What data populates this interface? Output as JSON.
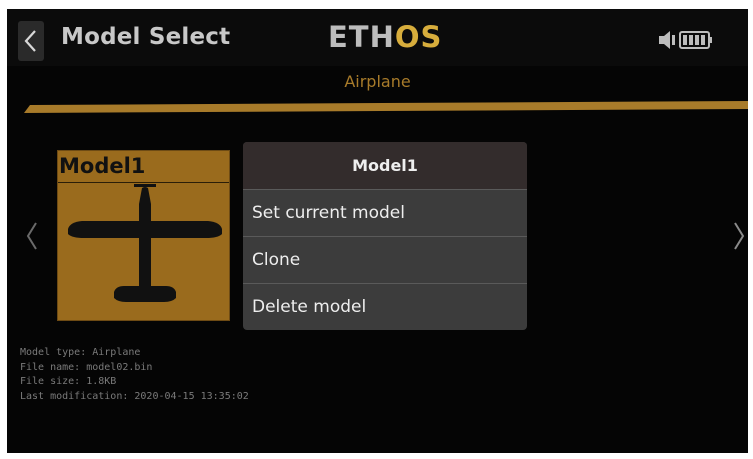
{
  "header": {
    "back_icon": "chevron-left-icon",
    "title": "Model Select",
    "logo_part1": "ETH",
    "logo_part2": "OS",
    "status_icons": [
      "speaker-icon",
      "battery-icon"
    ]
  },
  "subtitle": "Airplane",
  "colors": {
    "accent_gold": "#d7ad3c",
    "subtitle_gold": "#a87b2a",
    "card_bg": "#9a6b1d",
    "menu_bg": "#3c3c3c"
  },
  "model_card": {
    "name": "Model1",
    "image": "airplane-silhouette-icon"
  },
  "navigation": {
    "prev_icon": "chevron-left-icon",
    "next_icon": "chevron-right-icon"
  },
  "context_menu": {
    "title": "Model1",
    "items": [
      {
        "label": "Set current model"
      },
      {
        "label": "Clone"
      },
      {
        "label": "Delete model"
      }
    ]
  },
  "model_info": {
    "type": "Model type: Airplane",
    "file_name": "File name: model02.bin",
    "file_size": "File size: 1.8KB",
    "last_modification": "Last modification: 2020-04-15 13:35:02"
  }
}
